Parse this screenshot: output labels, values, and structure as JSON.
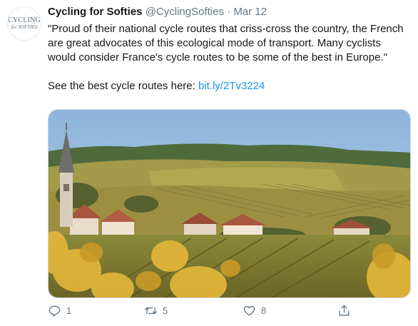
{
  "tweet": {
    "display_name": "Cycling for Softies",
    "handle": "@CyclingSofties",
    "separator": "·",
    "date": "Mar 12",
    "avatar_line1": "CYCLING",
    "avatar_line2": "for SOFTIES",
    "text": "\"Proud of their national cycle routes that criss-cross the country, the French are great advocates of this ecological mode of transport. Many cyclists would consider France's cycle routes to be some of the best in Europe.\"",
    "cta_text": "See the best cycle routes here: ",
    "link_text": "bit.ly/2Tv3224"
  },
  "actions": {
    "reply_count": "1",
    "retweet_count": "5",
    "like_count": "8"
  },
  "colors": {
    "link": "#1b95e0",
    "muted": "#657786",
    "text": "#14171a"
  },
  "icons": [
    "reply-icon",
    "retweet-icon",
    "like-icon",
    "share-icon"
  ]
}
